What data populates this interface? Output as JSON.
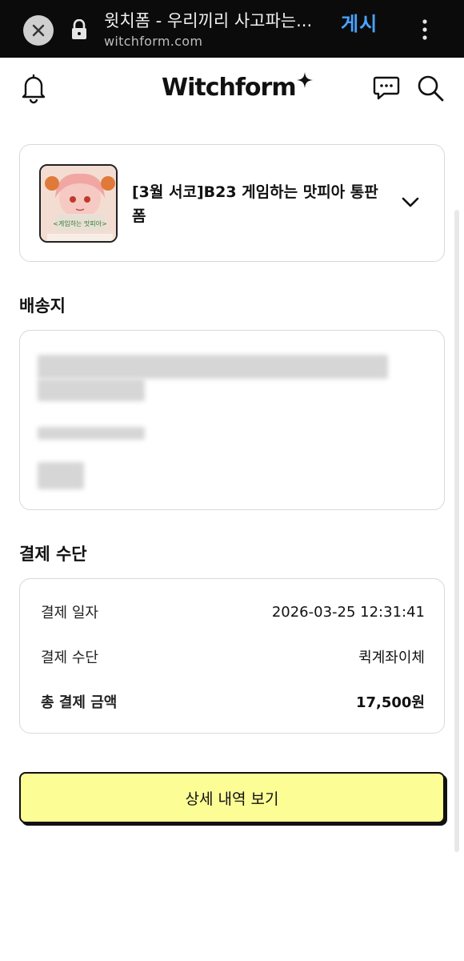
{
  "browser": {
    "title": "윗치폼 - 우리끼리 사고파는...",
    "url": "witchform.com",
    "post_label": "게시"
  },
  "header": {
    "logo_text": "Witchform"
  },
  "form": {
    "name": "[3월 서코]B23 게임하는 맛피아 통판 폼",
    "thumbnail_caption": "<게임하는 맛피아>"
  },
  "shipping": {
    "title": "배송지"
  },
  "payment": {
    "title": "결제 수단",
    "rows": [
      {
        "label": "결제 일자",
        "value": "2026-03-25 12:31:41"
      },
      {
        "label": "결제 수단",
        "value": "퀵계좌이체"
      },
      {
        "label": "총 결제 금액",
        "value": "17,500원"
      }
    ]
  },
  "detail_button_label": "상세 내역 보기",
  "colors": {
    "browser_bar": "#0b0b0b",
    "post_button": "#4aa3ff",
    "detail_button_bg": "#fdfd96",
    "card_border": "#d9d9d9"
  }
}
